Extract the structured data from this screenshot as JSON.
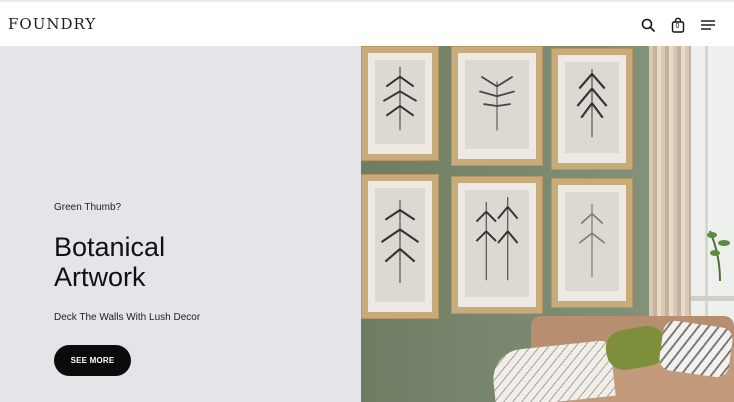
{
  "header": {
    "logo": "FOUNDRY",
    "icons": [
      "search-icon",
      "shopping-bag-icon",
      "menu-icon"
    ],
    "cart_count": "0"
  },
  "hero": {
    "eyebrow": "Green Thumb?",
    "title_line1": "Botanical",
    "title_line2": "Artwork",
    "subtitle": "Deck The Walls With Lush Decor",
    "cta_label": "SEE MORE"
  },
  "colors": {
    "left_panel": "#e4e5e8",
    "button": "#0b0b0b",
    "wall": "#75836a",
    "frame": "#c8ab7b"
  }
}
